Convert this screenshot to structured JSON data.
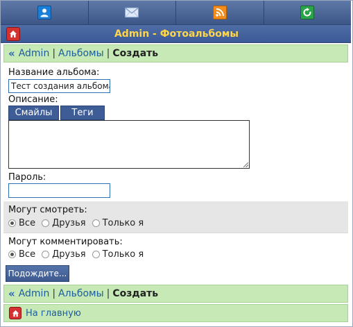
{
  "top_icons": [
    "user-icon",
    "mail-icon",
    "rss-icon",
    "refresh-icon"
  ],
  "header": {
    "title": "Admin - Фотоальбомы",
    "home_icon": "home-icon"
  },
  "breadcrumb": {
    "arrow": "«",
    "items": [
      "Admin",
      "Альбомы"
    ],
    "separator": "|",
    "current": "Создать"
  },
  "form": {
    "album_name_label": "Название альбома:",
    "album_name_value": "Тест создания альбома",
    "description_label": "Описание:",
    "tabs": [
      "Смайлы",
      "Теги"
    ],
    "description_value": "",
    "password_label": "Пароль:",
    "password_value": "",
    "can_view_label": "Могут смотреть:",
    "can_view_options": [
      "Все",
      "Друзья",
      "Только я"
    ],
    "can_view_selected": "Все",
    "can_comment_label": "Могут комментировать:",
    "can_comment_options": [
      "Все",
      "Друзья",
      "Только я"
    ],
    "can_comment_selected": "Все",
    "submit_label": "Подождите..."
  },
  "footer": {
    "home_link": "На главную"
  },
  "colors": {
    "header_bg": "#3b5996",
    "title_text": "#ffd54a",
    "crumb_bg": "#c6e9b6",
    "link": "#1d5d9a"
  }
}
